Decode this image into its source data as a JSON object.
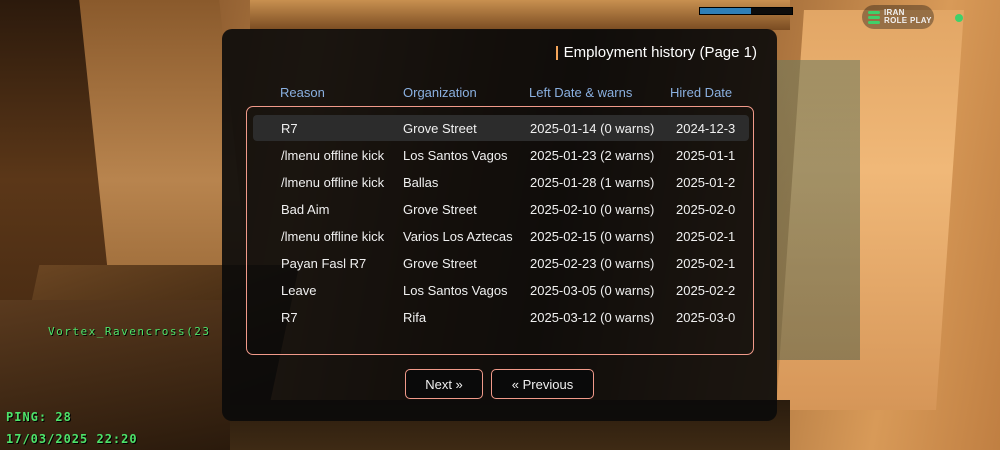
{
  "hud": {
    "health_fill": 0.55,
    "logo_line1": "IRAN",
    "logo_line2": "ROLE PLAY",
    "player_name": "Vortex_Ravencross(23",
    "ping": "PING: 28",
    "datetime": "17/03/2025 22:20",
    "colors": {
      "hud_text": "#4ee36a",
      "accent": "#f19a8a",
      "header_text": "#8ab0e0"
    }
  },
  "dialog": {
    "title": "Employment history (Page 1)",
    "columns": [
      "Reason",
      "Organization",
      "Left Date & warns",
      "Hired Date"
    ],
    "rows": [
      {
        "reason": "R7",
        "organization": "Grove Street",
        "left": "2025-01-14 (0 warns)",
        "hired": "2024-12-3"
      },
      {
        "reason": "/lmenu offline kick",
        "organization": "Los Santos Vagos",
        "left": "2025-01-23 (2 warns)",
        "hired": "2025-01-1"
      },
      {
        "reason": "/lmenu offline kick",
        "organization": "Ballas",
        "left": "2025-01-28 (1 warns)",
        "hired": "2025-01-2"
      },
      {
        "reason": "Bad Aim",
        "organization": "Grove Street",
        "left": "2025-02-10 (0 warns)",
        "hired": "2025-02-0"
      },
      {
        "reason": "/lmenu offline kick",
        "organization": "Varios Los Aztecas",
        "left": "2025-02-15 (0 warns)",
        "hired": "2025-02-1"
      },
      {
        "reason": "Payan Fasl R7",
        "organization": "Grove Street",
        "left": "2025-02-23 (0 warns)",
        "hired": "2025-02-1"
      },
      {
        "reason": "Leave",
        "organization": "Los Santos Vagos",
        "left": "2025-03-05 (0 warns)",
        "hired": "2025-02-2"
      },
      {
        "reason": "R7",
        "organization": "Rifa",
        "left": "2025-03-12 (0 warns)",
        "hired": "2025-03-0"
      }
    ],
    "buttons": {
      "next": "Next »",
      "previous": "« Previous"
    }
  }
}
